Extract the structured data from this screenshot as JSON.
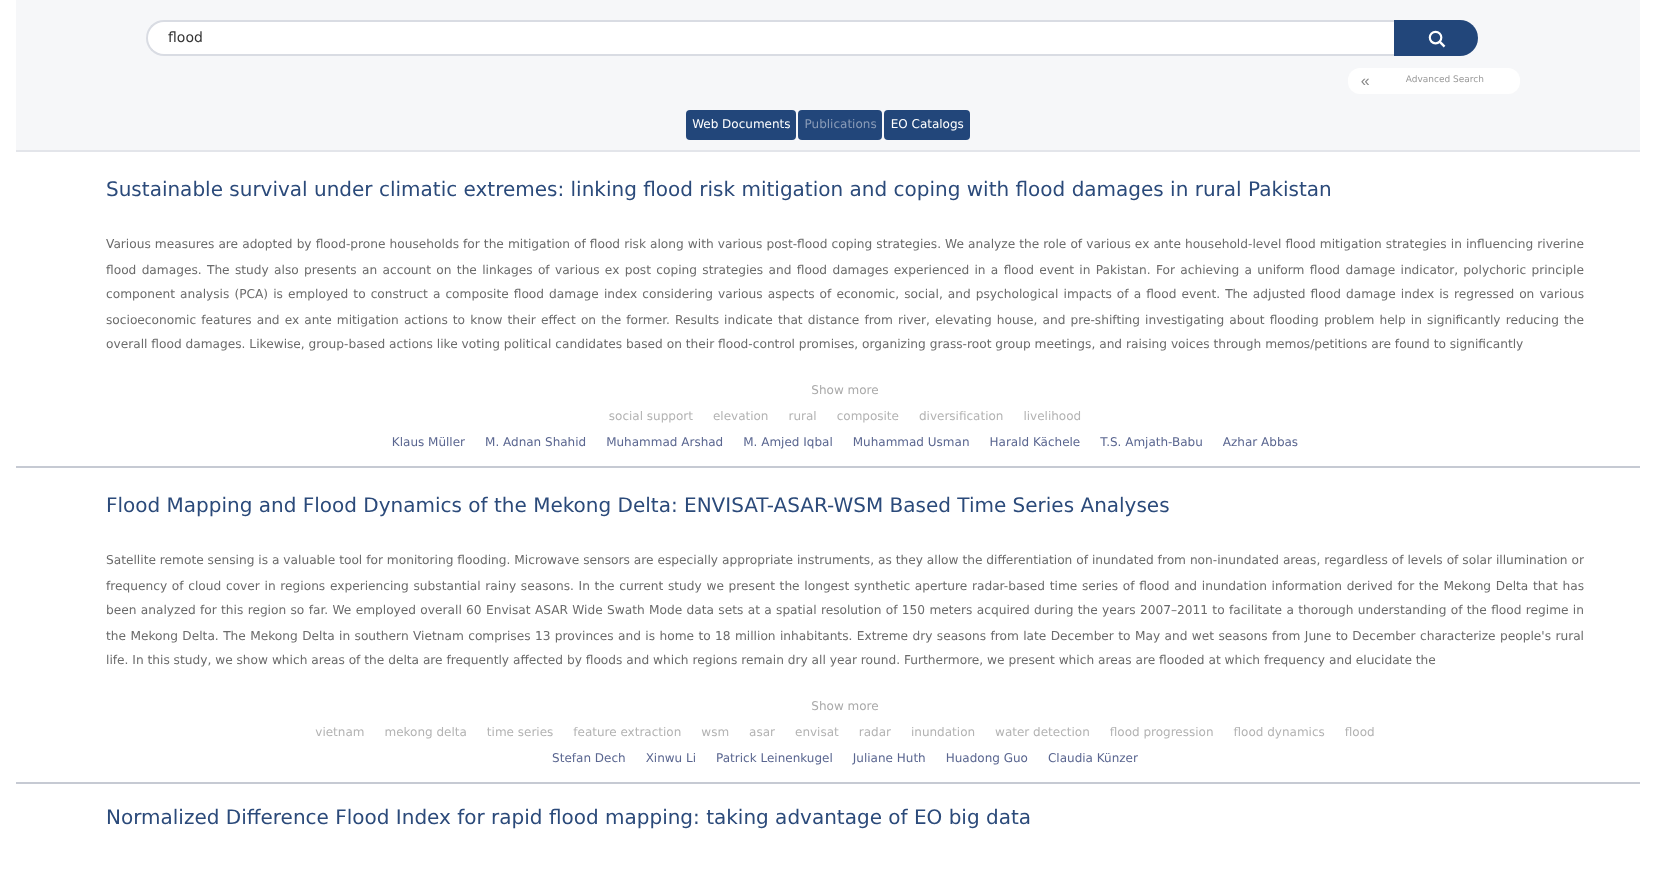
{
  "search": {
    "value": "flood"
  },
  "advanced_search": {
    "toggle": "«",
    "label": "Advanced Search"
  },
  "tabs": [
    {
      "label": "Web Documents",
      "selected": false
    },
    {
      "label": "Publications",
      "selected": true
    },
    {
      "label": "EO Catalogs",
      "selected": false
    }
  ],
  "results": [
    {
      "title": "Sustainable survival under climatic extremes: linking flood risk mitigation and coping with flood damages in rural Pakistan",
      "abstract": "Various measures are adopted by flood-prone households for the mitigation of flood risk along with various post-flood coping strategies. We analyze the role of various ex ante household-level flood mitigation strategies in influencing riverine flood damages. The study also presents an account on the linkages of various ex post coping strategies and flood damages experienced in a flood event in Pakistan. For achieving a uniform flood damage indicator, polychoric principle component analysis (PCA) is employed to construct a composite flood damage index considering various aspects of economic, social, and psychological impacts of a flood event. The adjusted flood damage index is regressed on various socioeconomic features and ex ante mitigation actions to know their effect on the former. Results indicate that distance from river, elevating house, and pre-shifting investigating about flooding problem help in significantly reducing the overall flood damages. Likewise, group-based actions like voting political candidates based on their flood-control promises, organizing grass-root group meetings, and raising voices through memos/petitions are found to significantly",
      "show_more": "Show more",
      "keywords": [
        "social support",
        "elevation",
        "rural",
        "composite",
        "diversification",
        "livelihood"
      ],
      "authors": [
        "Klaus Müller",
        "M. Adnan Shahid",
        "Muhammad Arshad",
        "M. Amjed Iqbal",
        "Muhammad Usman",
        "Harald Kächele",
        "T.S. Amjath-Babu",
        "Azhar Abbas"
      ]
    },
    {
      "title": "Flood Mapping and Flood Dynamics of the Mekong Delta: ENVISAT-ASAR-WSM Based Time Series Analyses",
      "abstract": "Satellite remote sensing is a valuable tool for monitoring flooding. Microwave sensors are especially appropriate instruments, as they allow the differentiation of inundated from non-inundated areas, regardless of levels of solar illumination or frequency of cloud cover in regions experiencing substantial rainy seasons. In the current study we present the longest synthetic aperture radar-based time series of flood and inundation information derived for the Mekong Delta that has been analyzed for this region so far. We employed overall 60 Envisat ASAR Wide Swath Mode data sets at a spatial resolution of 150 meters acquired during the years 2007–2011 to facilitate a thorough understanding of the flood regime in the Mekong Delta. The Mekong Delta in southern Vietnam comprises 13 provinces and is home to 18 million inhabitants. Extreme dry seasons from late December to May and wet seasons from June to December characterize people's rural life. In this study, we show which areas of the delta are frequently affected by floods and which regions remain dry all year round. Furthermore, we present which areas are flooded at which frequency and elucidate the",
      "show_more": "Show more",
      "keywords": [
        "vietnam",
        "mekong delta",
        "time series",
        "feature extraction",
        "wsm",
        "asar",
        "envisat",
        "radar",
        "inundation",
        "water detection",
        "flood progression",
        "flood dynamics",
        "flood"
      ],
      "authors": [
        "Stefan Dech",
        "Xinwu Li",
        "Patrick Leinenkugel",
        "Juliane Huth",
        "Huadong Guo",
        "Claudia Künzer"
      ]
    },
    {
      "title": "Normalized Difference Flood Index for rapid flood mapping: taking advantage of EO big data"
    }
  ]
}
